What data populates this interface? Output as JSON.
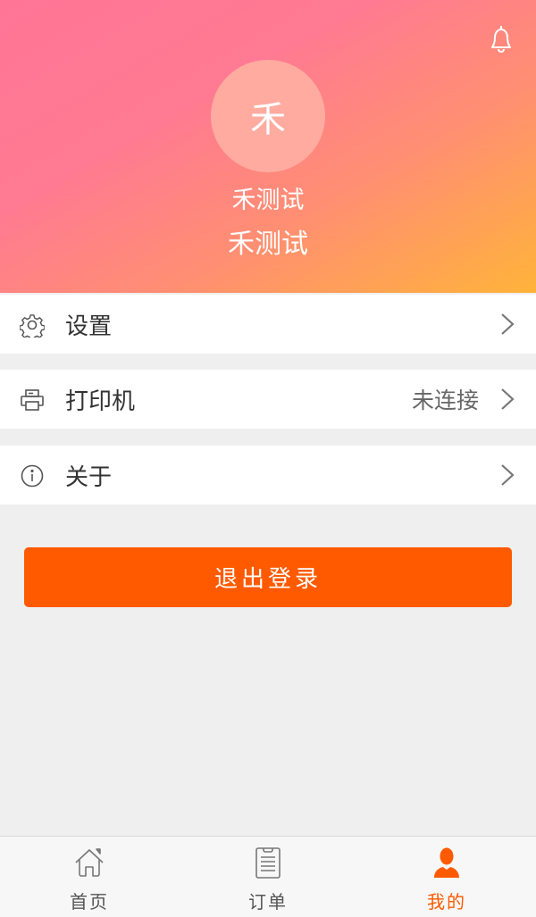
{
  "header": {
    "avatar_char": "禾",
    "name_primary": "禾测试",
    "name_secondary": "禾测试",
    "notification_icon": "bell-icon"
  },
  "menu": [
    {
      "id": "settings",
      "label": "设置",
      "icon": "gear-icon",
      "value": ""
    },
    {
      "id": "printer",
      "label": "打印机",
      "icon": "printer-icon",
      "value": "未连接"
    },
    {
      "id": "about",
      "label": "关于",
      "icon": "info-icon",
      "value": ""
    }
  ],
  "logout_label": "退出登录",
  "tabbar": {
    "items": [
      {
        "id": "home",
        "label": "首页",
        "icon": "home-icon",
        "active": false
      },
      {
        "id": "orders",
        "label": "订单",
        "icon": "order-list-icon",
        "active": false
      },
      {
        "id": "mine",
        "label": "我的",
        "icon": "user-icon",
        "active": true
      }
    ]
  },
  "colors": {
    "accent": "#ff5a00",
    "gradient_start": "#ff7596",
    "gradient_end": "#ffb33a",
    "background": "#efefef"
  }
}
